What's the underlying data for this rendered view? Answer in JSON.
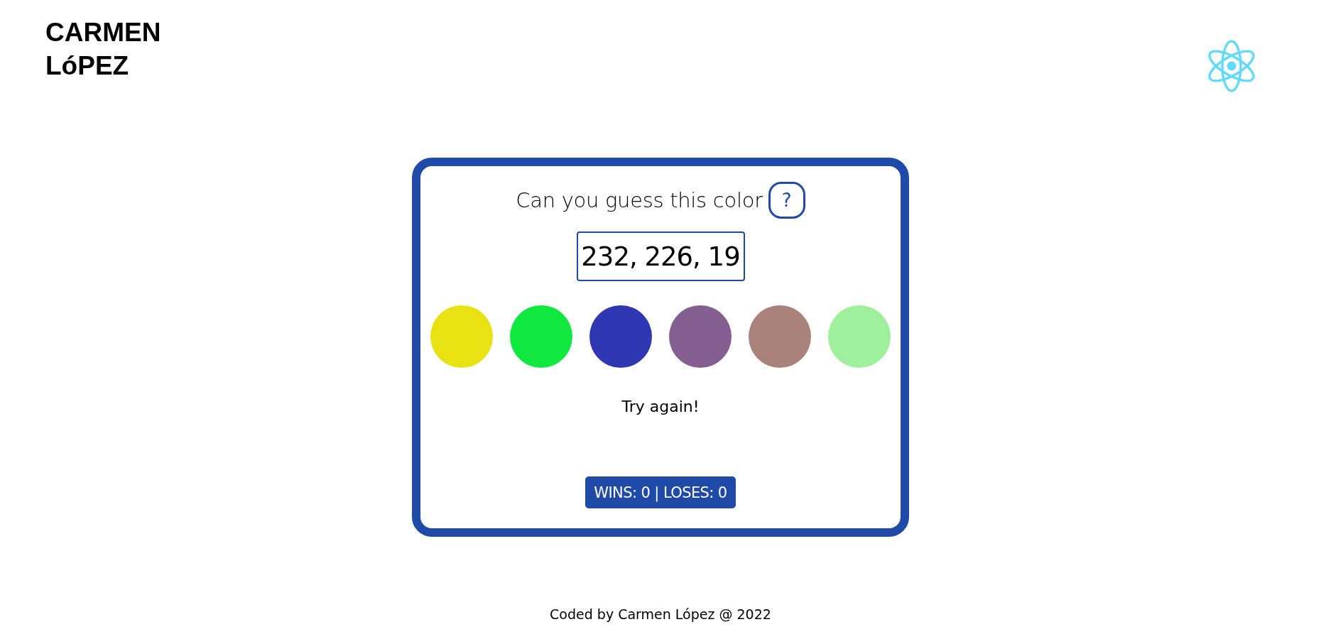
{
  "header": {
    "logo_lines": [
      "CARMEN",
      "LóPEZ"
    ]
  },
  "game": {
    "prompt": "Can you guess this color",
    "help_button": "?",
    "rgb_code": "232, 226, 19",
    "options": [
      {
        "color": "#e8e213"
      },
      {
        "color": "#10e840"
      },
      {
        "color": "#2f37b3"
      },
      {
        "color": "#855f91"
      },
      {
        "color": "#aa827c"
      },
      {
        "color": "#9ff09d"
      }
    ],
    "message": "Try again!",
    "score": "WINS: 0 | LOSES: 0"
  },
  "footer": {
    "text": "Coded by Carmen López @ 2022"
  }
}
